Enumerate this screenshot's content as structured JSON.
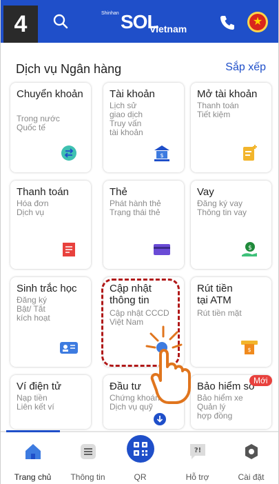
{
  "step_badge": "4",
  "header": {
    "logo_small": "Shinhan",
    "logo_main": "SOL",
    "logo_country": "Vietnam",
    "icons": [
      "search-icon",
      "phone-icon",
      "vietnam-flag-icon"
    ],
    "color": "#1f4fc9"
  },
  "section": {
    "title": "Dịch vụ Ngân hàng",
    "sort_label": "Sắp xếp"
  },
  "cards": [
    {
      "title": "Chuyển khoản",
      "subs": "Trong nước\nQuốc tế",
      "icon": "transfer-icon"
    },
    {
      "title": "Tài khoản",
      "subs": "Lịch sử\ngiao dịch\nTruy vấn\ntài khoản",
      "icon": "bank-icon"
    },
    {
      "title": "Mở tài khoản",
      "subs": "Thanh toán\nTiết kiệm",
      "icon": "new-account-icon"
    },
    {
      "title": "Thanh toán",
      "subs": "Hóa đơn\nDịch vụ",
      "icon": "bill-icon"
    },
    {
      "title": "Thẻ",
      "subs": "Phát hành thẻ\nTrạng thái thẻ",
      "icon": "card-icon"
    },
    {
      "title": "Vay",
      "subs": "Đăng ký vay\nThông tin vay",
      "icon": "loan-icon"
    },
    {
      "title": "Sinh trắc học",
      "subs": "Đăng ký\nBật/ Tắt\nkích hoạt",
      "icon": "biometric-icon"
    },
    {
      "title": "Cập nhật\nthông tin",
      "subs": "Cập nhật CCCD\nViệt Nam",
      "icon": "update-info-icon"
    },
    {
      "title": "Rút tiền\ntại ATM",
      "subs": "Rút tiền mặt",
      "icon": "atm-icon"
    },
    {
      "title": "Ví điện tử",
      "subs": "Nạp tiền\nLiên kết ví",
      "icon": ""
    },
    {
      "title": "Đầu tư",
      "subs": "Chứng khoán\nDịch vụ quỹ",
      "icon": "download-icon"
    },
    {
      "title": "Bảo hiểm số",
      "subs": "Bảo hiểm xe\nQuản lý\nhợp đồng",
      "icon": ""
    }
  ],
  "new_badge": "Mới",
  "nav": [
    {
      "label": "Trang chủ",
      "icon": "home-icon",
      "active": true
    },
    {
      "label": "Thông tin",
      "icon": "list-icon",
      "active": false
    },
    {
      "label": "QR",
      "icon": "qr-icon",
      "active": false
    },
    {
      "label": "Hỗ trợ",
      "icon": "support-icon",
      "active": false
    },
    {
      "label": "Cài đặt",
      "icon": "settings-icon",
      "active": false
    }
  ],
  "colors": {
    "brand": "#1f4fc9",
    "highlight": "#b01818",
    "hand": "#e0751e"
  }
}
